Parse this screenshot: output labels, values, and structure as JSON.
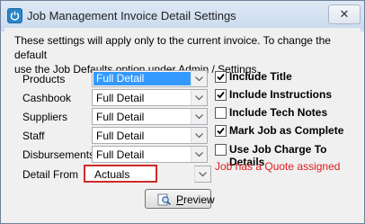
{
  "window": {
    "title": "Job Management Invoice Detail Settings",
    "close_glyph": "✕",
    "app_icon": "power-icon"
  },
  "info_text_line1": "These settings will apply only to the current invoice.  To change the default",
  "info_text_line2": "use the Job Defaults option under Admin / Settings.",
  "fields": [
    {
      "label": "Products",
      "value": "Full Detail"
    },
    {
      "label": "Cashbook",
      "value": "Full Detail"
    },
    {
      "label": "Suppliers",
      "value": "Full Detail"
    },
    {
      "label": "Staff",
      "value": "Full Detail"
    },
    {
      "label": "Disbursements",
      "value": "Full Detail"
    },
    {
      "label": "Detail From",
      "value": "Actuals"
    }
  ],
  "options": [
    {
      "label": "Include Title",
      "checked": true
    },
    {
      "label": "Include Instructions",
      "checked": true
    },
    {
      "label": "Include Tech Notes",
      "checked": false
    },
    {
      "label": "Mark Job as Complete",
      "checked": true
    },
    {
      "label": "Use Job Charge To Details",
      "checked": false
    }
  ],
  "warning": "Job has a Quote assigned",
  "colors": {
    "warning": "#e01b1b",
    "selection": "#3399ff",
    "focus_border": "#d02a2a"
  },
  "preview_button": {
    "prefix": "",
    "mnemonic": "P",
    "rest": "review",
    "icon": "magnifier-icon"
  }
}
